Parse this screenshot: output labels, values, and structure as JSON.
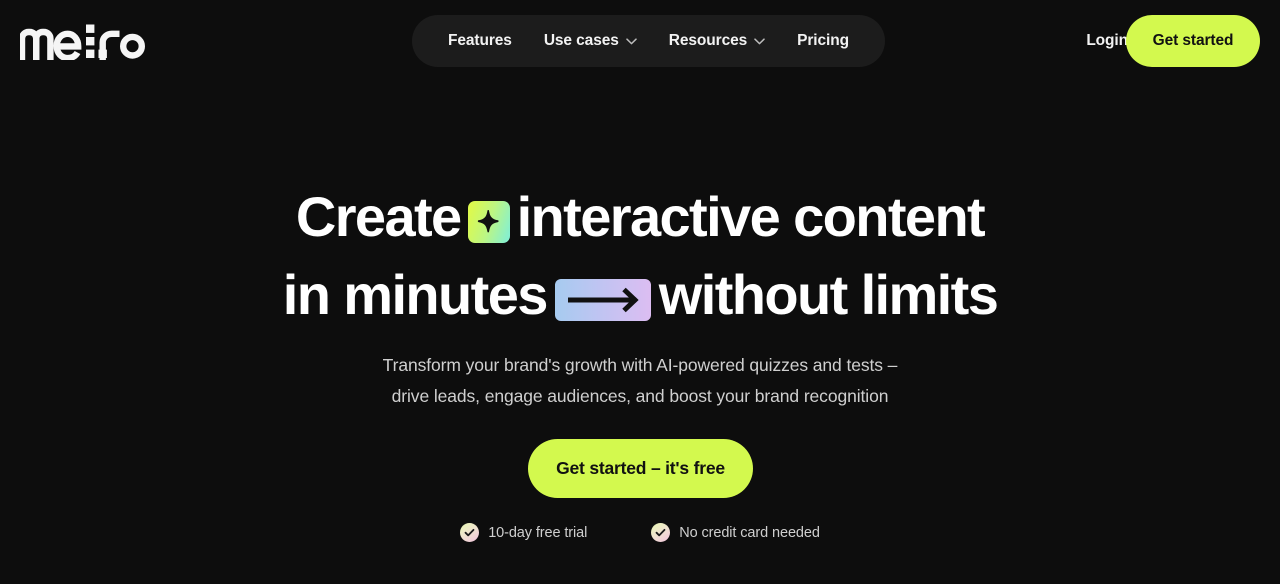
{
  "brand": {
    "logo_text": "meiro"
  },
  "nav": {
    "items": [
      {
        "label": "Features",
        "has_dropdown": false,
        "icon": ""
      },
      {
        "label": "Use cases",
        "has_dropdown": true,
        "icon": "chevron-down-icon"
      },
      {
        "label": "Resources",
        "has_dropdown": true,
        "icon": "chevron-down-icon"
      },
      {
        "label": "Pricing",
        "has_dropdown": false,
        "icon": ""
      }
    ],
    "login_label": "Login",
    "get_started_label": "Get started"
  },
  "hero": {
    "headline_line1_before": "Create",
    "headline_line1_after": "interactive content",
    "headline_line2_before": "in minutes",
    "headline_line2_after": "without limits",
    "sparkle_icon": "sparkle-badge-icon",
    "arrow_icon": "arrow-right-badge-icon",
    "subtitle_line1": "Transform your brand's growth with AI-powered quizzes and tests –",
    "subtitle_line2": "drive leads, engage audiences, and boost your brand recognition",
    "cta_label": "Get started – it's free",
    "trust": [
      {
        "icon": "check-circle-icon",
        "label": "10-day free trial"
      },
      {
        "icon": "check-circle-icon",
        "label": "No credit card needed"
      }
    ]
  },
  "colors": {
    "background": "#0d0d0d",
    "nav_pill": "#1c1c1c",
    "accent_lime": "#d3f94e",
    "text_primary": "#ffffff",
    "text_secondary": "#cfcfcf",
    "sparkle_gradient_from": "#d8f94e",
    "sparkle_gradient_to": "#8df0c8",
    "arrow_gradient_from": "#a9cdf0",
    "arrow_gradient_to": "#d8bdf2",
    "check_gradient_from": "#e8f5b8",
    "check_gradient_to": "#f2c9dc"
  }
}
